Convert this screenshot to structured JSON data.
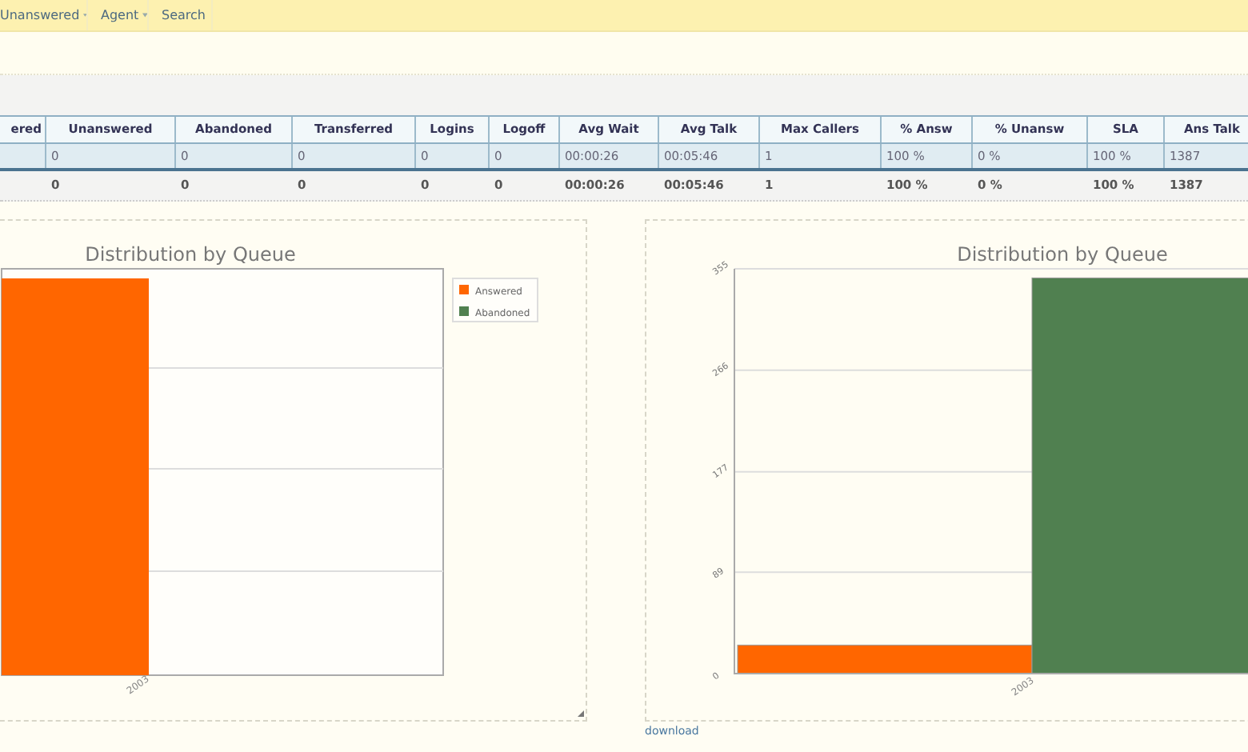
{
  "nav": {
    "items": [
      {
        "label": "Unanswered",
        "dropdown": true
      },
      {
        "label": "Agent",
        "dropdown": true
      },
      {
        "label": "Search",
        "dropdown": false
      }
    ]
  },
  "table": {
    "columns": [
      "ered",
      "Unanswered",
      "Abandoned",
      "Transferred",
      "Logins",
      "Logoff",
      "Avg Wait",
      "Avg Talk",
      "Max Callers",
      "% Answ",
      "% Unansw",
      "SLA",
      "Ans Talk"
    ],
    "rows": [
      [
        null,
        "0",
        "0",
        "0",
        "0",
        "0",
        "00:00:26",
        "00:05:46",
        "1",
        "100 %",
        "0 %",
        "100 %",
        "1387"
      ]
    ],
    "totals": [
      "0",
      "0",
      "0",
      "0",
      "0",
      "00:00:26",
      "00:05:46",
      "1",
      "100 %",
      "0 %",
      "100 %",
      "1387"
    ]
  },
  "left_chart": {
    "title": "Distribution by Queue",
    "category": "2003",
    "legend": [
      {
        "label": "Answered",
        "color": "#ff6600"
      },
      {
        "label": "Abandoned",
        "color": "#508050"
      }
    ]
  },
  "right_chart": {
    "chart_data": {
      "type": "bar",
      "title": "Distribution by Queue",
      "categories": [
        "2003"
      ],
      "series": [
        {
          "color": "#ff6600",
          "values": [
            25
          ]
        },
        {
          "color": "#508050",
          "values": [
            347
          ]
        }
      ],
      "ylim": [
        0,
        355
      ],
      "grid": true,
      "yticks": [
        0,
        89,
        177,
        266,
        355
      ]
    },
    "link": "download"
  }
}
